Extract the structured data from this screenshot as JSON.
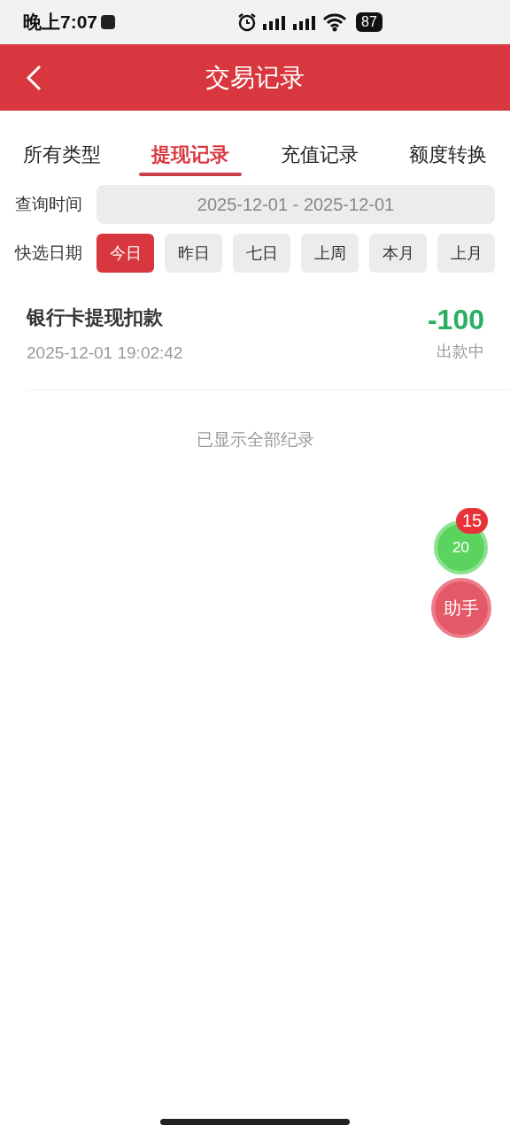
{
  "status_bar": {
    "time": "晚上7:07",
    "battery": "87"
  },
  "header": {
    "title": "交易记录"
  },
  "tabs": [
    {
      "label": "所有类型",
      "selected": false
    },
    {
      "label": "提现记录",
      "selected": true
    },
    {
      "label": "充值记录",
      "selected": false
    },
    {
      "label": "额度转换",
      "selected": false
    }
  ],
  "query": {
    "label": "查询时间",
    "value": "2025-12-01 - 2025-12-01"
  },
  "quick_dates": {
    "label": "快选日期",
    "options": [
      {
        "label": "今日",
        "selected": true
      },
      {
        "label": "昨日",
        "selected": false
      },
      {
        "label": "七日",
        "selected": false
      },
      {
        "label": "上周",
        "selected": false
      },
      {
        "label": "本月",
        "selected": false
      },
      {
        "label": "上月",
        "selected": false
      }
    ]
  },
  "records": [
    {
      "title": "银行卡提现扣款",
      "time": "2025-12-01 19:02:42",
      "amount": "-100",
      "status": "出款中"
    }
  ],
  "footer_note": "已显示全部纪录",
  "floating": {
    "count": "20",
    "badge": "15",
    "assistant": "助手"
  }
}
